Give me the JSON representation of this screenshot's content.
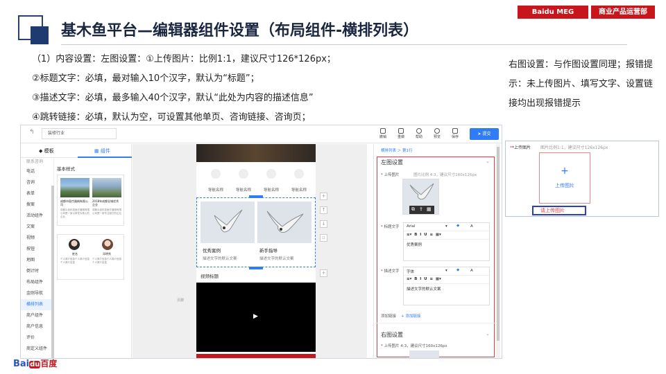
{
  "header": {
    "title": "基木鱼平台—编辑器组件设置（布局组件-横排列表）",
    "badge_left": "Baidu MEG",
    "badge_right": "商业产品运营部"
  },
  "description": {
    "line1": "（1）内容设置：左图设置：①上传图片：比例1:1，建议尺寸126*126px；",
    "line2": "②标题文字：必填，最对输入10个汉字，默认为“标题”；",
    "line3": "③描述文字：必填，最多输入40个汉字，默认“此处为内容的描述信息”",
    "line4": "④跳转链接：必填，默认为空，可设置其他单页、咨询链接、咨询页；"
  },
  "right_note": {
    "text": "右图设置：与作图设置同理；报错提示：未上传图片、填写文字、设置链接均出现报错提示"
  },
  "editor": {
    "page_name": "装修行业",
    "toolbar": [
      "撤销",
      "重做",
      "帮助",
      "预览",
      "保存"
    ],
    "submit": "提交",
    "left_tabs": [
      "模板",
      "组件"
    ],
    "nav_items": [
      "联系咨询",
      "电话",
      "咨询",
      "表单",
      "拨案",
      "活动组件",
      "文案",
      "视频",
      "按钮",
      "地图",
      "倒计时",
      "布局组件",
      "金刚导航",
      "横排列表",
      "商户组件",
      "商户信息",
      "评价",
      "商定义组件"
    ],
    "basic_style": "基本样式",
    "card1_titles": [
      "成都市医疗器械有限公司",
      "2018年成都业城优秀企业"
    ],
    "card1_texts": [
      "成都众创科技医疗器械有限公司是一家以研发为核心的企业",
      "成都众创科技医疗器械有限公司是一家专注医疗的企业"
    ],
    "card2_names": [
      "姓名",
      "邓明秀"
    ],
    "card2_texts": [
      "个人简介信息个人简介信息个人简介信息",
      "个人简介信息个人简介信息个人简介信息"
    ],
    "nav_labels": [
      "导航名称",
      "导航名称",
      "导航名称",
      "导航名称"
    ],
    "item1_title": "优秀案例",
    "item1_desc": "描述文字的默认文案",
    "item2_title": "新手指导",
    "item2_desc": "描述文字的默认文案",
    "video_title": "视频标题",
    "footer_label": "页脚",
    "breadcrumb": "横排列表 ＞ 第1行",
    "left_section": "左图设置",
    "upload_label": "* 上传图片",
    "upload_hint": "图片比例 4:3，建议尺寸160x126px",
    "title_label": "* 标题文字",
    "title_font": "Arial",
    "title_value": "优秀案例",
    "desc_label": "* 描述文字",
    "desc_font": "字体",
    "desc_value": "描述文字的默认文案",
    "link_label": "添加链接",
    "link_action": "+ 添加链接",
    "right_section": "右图设置",
    "right_upload_hint": "* 上传图片 4:3，建议尺寸160x126px"
  },
  "error_preview": {
    "label": "*上传图片",
    "hint": "图片比例1:1，建议尺寸126x126px",
    "plus": "+",
    "button": "上传图片",
    "error": "请上传图片"
  },
  "footer": {
    "logo": "Bai",
    "logo_paw": "du",
    "logo_cn": "百度"
  },
  "colors": {
    "accent": "#2f7cf6",
    "brand_red": "#c8161d",
    "error_red": "#e03c3c",
    "title_navy": "#1a2640"
  }
}
